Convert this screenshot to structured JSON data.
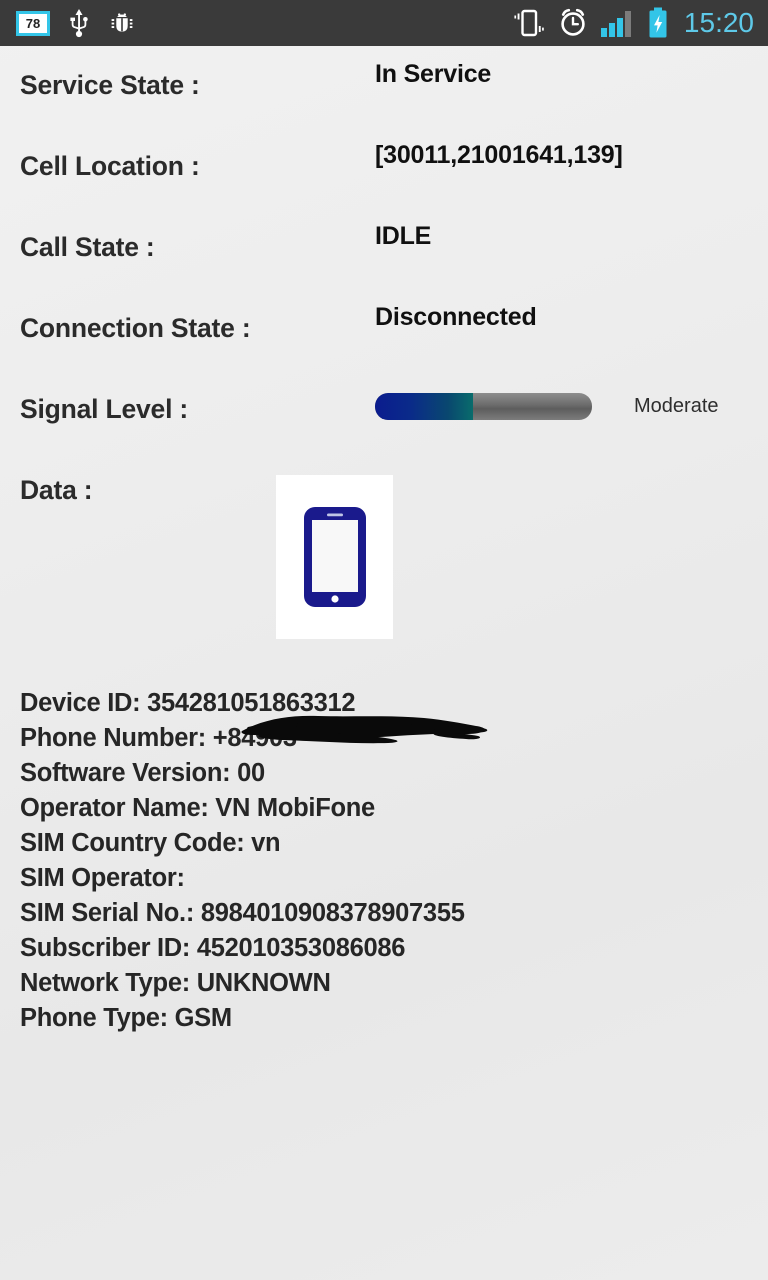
{
  "status_bar": {
    "download_badge": "78",
    "icons": [
      "download-badge-icon",
      "usb-icon",
      "android-debug-bug-icon",
      "vibrate-icon",
      "alarm-clock-icon",
      "signal-bars-icon",
      "battery-charging-icon"
    ],
    "clock": "15:20",
    "accent_color": "#5ec9e8",
    "background_color": "#3a3a3a"
  },
  "rows": [
    {
      "label": "Service State :",
      "value": "In Service"
    },
    {
      "label": "Cell Location :",
      "value": "[30011,21001641,139]"
    },
    {
      "label": "Call State :",
      "value": "IDLE"
    },
    {
      "label": "Connection State :",
      "value": "Disconnected"
    }
  ],
  "signal": {
    "label": "Signal Level :",
    "description": "Moderate",
    "percent": 45,
    "fill_color_start": "#0b1c8e",
    "fill_color_end": "#096c6c",
    "track_color": "#6e6e6e"
  },
  "data": {
    "label": "Data :",
    "icon": "smartphone-icon",
    "icon_color": "#1a1a8c",
    "box_color": "#ffffff"
  },
  "info": [
    {
      "key": "Device ID:",
      "value": "354281051863312",
      "redacted": false
    },
    {
      "key": "Phone Number:",
      "value": "+84903",
      "redacted": true
    },
    {
      "key": "Software Version:",
      "value": "00",
      "redacted": false
    },
    {
      "key": "Operator Name:",
      "value": "VN MobiFone",
      "redacted": false
    },
    {
      "key": "SIM Country Code:",
      "value": "vn",
      "redacted": false
    },
    {
      "key": "SIM Operator:",
      "value": "",
      "redacted": false
    },
    {
      "key": "SIM Serial No.:",
      "value": "8984010908378907355",
      "redacted": false
    },
    {
      "key": "Subscriber ID:",
      "value": "452010353086086",
      "redacted": false
    },
    {
      "key": "Network Type:",
      "value": "UNKNOWN",
      "redacted": false
    },
    {
      "key": "Phone Type:",
      "value": "GSM",
      "redacted": false
    }
  ],
  "info_lines": {
    "device_id": "Device ID: 354281051863312",
    "phone_number": "Phone Number: +84903",
    "software_version": "Software Version: 00",
    "operator_name": "Operator Name: VN MobiFone",
    "sim_country_code": "SIM Country Code: vn",
    "sim_operator": "SIM Operator:",
    "sim_serial": "SIM Serial No.: 8984010908378907355",
    "subscriber_id": "Subscriber ID: 452010353086086",
    "network_type": "Network Type: UNKNOWN",
    "phone_type": "Phone Type: GSM"
  }
}
